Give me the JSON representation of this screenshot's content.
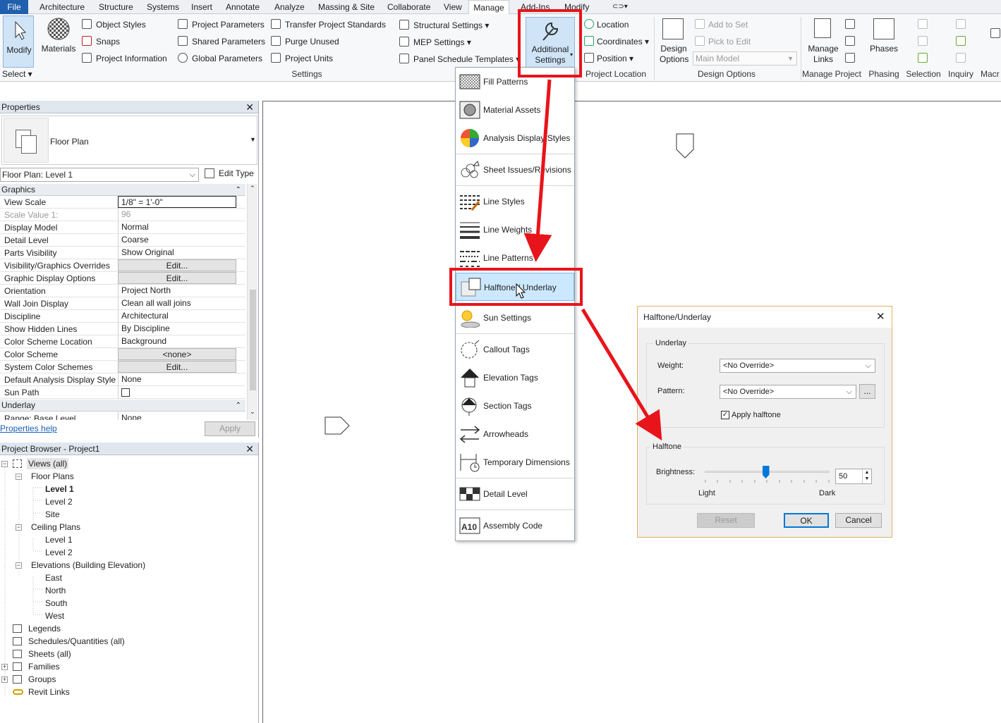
{
  "tabs": [
    "File",
    "Architecture",
    "Structure",
    "Systems",
    "Insert",
    "Annotate",
    "Analyze",
    "Massing & Site",
    "Collaborate",
    "View",
    "Manage",
    "Add-Ins",
    "Modify"
  ],
  "ribbon": {
    "modify": "Modify",
    "select": "Select ▾",
    "materials": "Materials",
    "object_styles": "Object  Styles",
    "snaps": "Snaps",
    "project_information": "Project  Information",
    "project_parameters": "Project  Parameters",
    "shared_parameters": "Shared  Parameters",
    "global_parameters": "Global  Parameters",
    "transfer_standards": "Transfer  Project Standards",
    "purge_unused": "Purge  Unused",
    "project_units": "Project  Units",
    "structural_settings": "Structural  Settings  ▾",
    "mep_settings": "MEP  Settings  ▾",
    "panel_schedule_templates": "Panel Schedule  Templates  ▾",
    "settings_caption": "Settings",
    "additional_settings_1": "Additional",
    "additional_settings_2": "Settings",
    "location": "Location",
    "coordinates": "Coordinates  ▾",
    "position": "Position  ▾",
    "project_location_caption": "Project Location",
    "design_options_1": "Design",
    "design_options_2": "Options",
    "add_to_set": "Add to Set",
    "pick_to_edit": "Pick to Edit",
    "main_model": "Main Model",
    "design_options_caption": "Design Options",
    "manage_links_1": "Manage",
    "manage_links_2": "Links",
    "manage_project_caption": "Manage Project",
    "phases": "Phases",
    "phasing_caption": "Phasing",
    "selection_caption": "Selection",
    "inquiry_caption": "Inquiry",
    "macros_caption": "Macr"
  },
  "properties": {
    "title": "Properties",
    "type_name": "Floor Plan",
    "instance": "Floor Plan: Level 1",
    "edit_type": "Edit Type",
    "group_graphics": "Graphics",
    "group_underlay": "Underlay",
    "rows": [
      {
        "k": "View Scale",
        "v": "1/8\" = 1'-0\""
      },
      {
        "k": "Scale Value    1:",
        "v": "96"
      },
      {
        "k": "Display Model",
        "v": "Normal"
      },
      {
        "k": "Detail Level",
        "v": "Coarse"
      },
      {
        "k": "Parts Visibility",
        "v": "Show Original"
      },
      {
        "k": "Visibility/Graphics Overrides",
        "v": "Edit..."
      },
      {
        "k": "Graphic Display Options",
        "v": "Edit..."
      },
      {
        "k": "Orientation",
        "v": "Project North"
      },
      {
        "k": "Wall Join Display",
        "v": "Clean all wall joins"
      },
      {
        "k": "Discipline",
        "v": "Architectural"
      },
      {
        "k": "Show Hidden Lines",
        "v": "By Discipline"
      },
      {
        "k": "Color Scheme Location",
        "v": "Background"
      },
      {
        "k": "Color Scheme",
        "v": "<none>"
      },
      {
        "k": "System Color Schemes",
        "v": "Edit..."
      },
      {
        "k": "Default Analysis Display Style",
        "v": "None"
      },
      {
        "k": "Sun Path",
        "v": ""
      },
      {
        "k": "Range: Base Level",
        "v": "None"
      }
    ],
    "help": "Properties help",
    "apply": "Apply"
  },
  "browser": {
    "title": "Project Browser - Project1",
    "views": "Views (all)",
    "floor_plans": "Floor Plans",
    "fp_level1": "Level 1",
    "fp_level2": "Level 2",
    "fp_site": "Site",
    "ceiling_plans": "Ceiling Plans",
    "cp_level1": "Level 1",
    "cp_level2": "Level 2",
    "elevations": "Elevations (Building Elevation)",
    "east": "East",
    "north": "North",
    "south": "South",
    "west": "West",
    "legends": "Legends",
    "schedules": "Schedules/Quantities (all)",
    "sheets": "Sheets (all)",
    "families": "Families",
    "groups": "Groups",
    "revit_links": "Revit Links"
  },
  "dropdown": {
    "items": [
      "Fill Patterns",
      "Material Assets",
      "Analysis Display Styles",
      "Sheet Issues/Revisions",
      "Line Styles",
      "Line Weights",
      "Line Patterns",
      "Halftone / Underlay",
      "Sun Settings",
      "Callout Tags",
      "Elevation Tags",
      "Section Tags",
      "Arrowheads",
      "Temporary Dimensions",
      "Detail Level",
      "Assembly Code"
    ]
  },
  "dialog": {
    "title": "Halftone/Underlay",
    "underlay": "Underlay",
    "weight_label": "Weight:",
    "weight_value": "<No Override>",
    "pattern_label": "Pattern:",
    "pattern_value": "<No Override>",
    "browse": "...",
    "apply_halftone": "Apply halftone",
    "halftone": "Halftone",
    "brightness_label": "Brightness:",
    "brightness": "50",
    "light": "Light",
    "dark": "Dark",
    "reset": "Reset",
    "ok": "OK",
    "cancel": "Cancel"
  },
  "colors": {
    "accent": "#1f5fae",
    "annotation": "#e8141b",
    "highlight": "#cce8ff"
  }
}
